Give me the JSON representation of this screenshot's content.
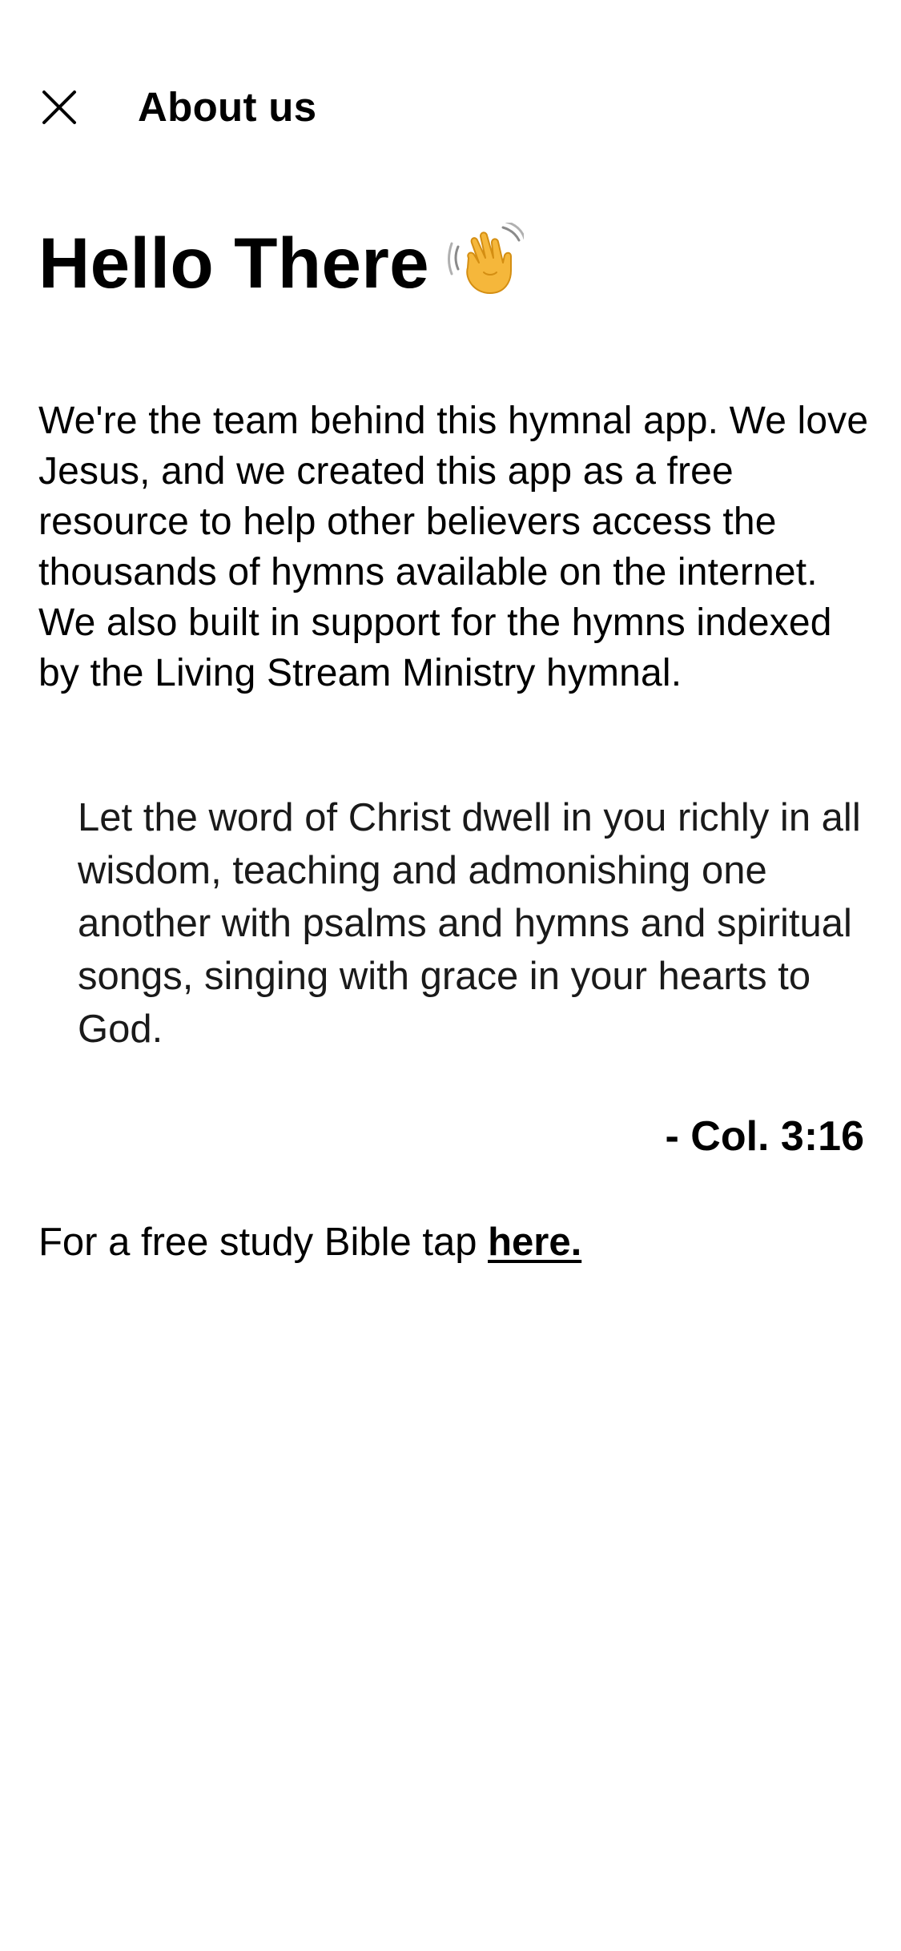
{
  "header": {
    "close_icon": "close-icon",
    "title": "About us"
  },
  "main": {
    "heading": "Hello There",
    "heading_emoji": "waving-hand-icon",
    "intro": "We're the team behind this hymnal app. We love Jesus, and we created this app as a free resource to help other believers access the thousands of hymns available on the internet. We also built in support for the hymns indexed by the Living Stream Ministry hymnal.",
    "quote": "Let the word of Christ dwell in you richly in all wisdom, teaching and admonishing one another with psalms and hymns and spiritual songs, singing with grace in your hearts to God.",
    "quote_reference": "- Col. 3:16",
    "study_prefix": "For a free study Bible tap ",
    "study_link_label": "here."
  },
  "colors": {
    "background": "#ffffff",
    "text": "#000000",
    "emoji_skin": "#F5B73B"
  }
}
